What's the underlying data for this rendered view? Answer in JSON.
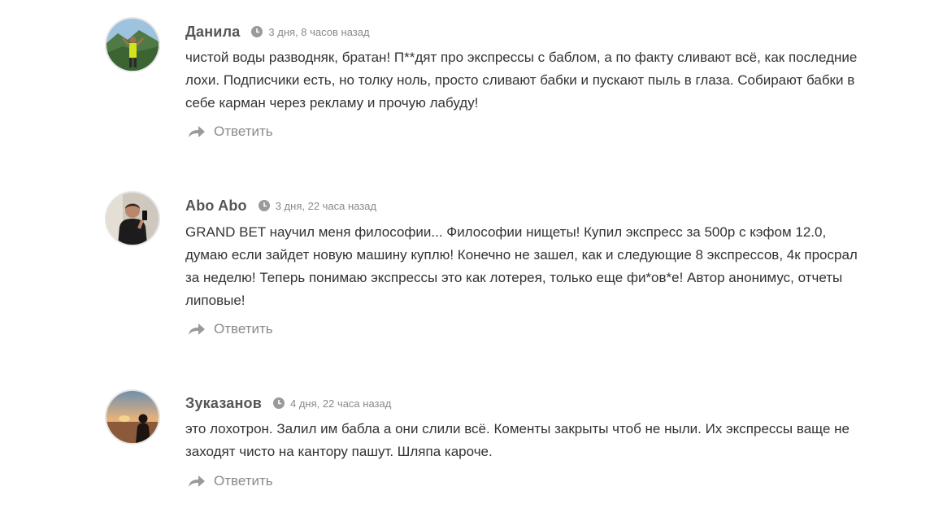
{
  "comments": [
    {
      "author": "Данила",
      "date": "3 дня, 8 часов назад",
      "avatar_icon": "user-photo-mountain",
      "text": "чистой воды разводняк, братан! П**дят про экспрессы с баблом, а по факту сливают всё, как последние лохи. Подписчики есть, но толку ноль, просто сливают бабки и пускают пыль в глаза. Собирают бабки в себе карман через рекламу и прочую лабуду!",
      "reply_label": "Ответить"
    },
    {
      "author": "Abo Abo",
      "date": "3 дня, 22 часа назад",
      "avatar_icon": "user-photo-selfie",
      "text": "GRAND BET научил меня философии... Философии нищеты! Купил экспресс за 500р с кэфом 12.0, думаю если зайдет новую машину куплю! Конечно не зашел, как и следующие 8 экспрессов, 4к просрал за неделю! Теперь понимаю экспрессы это как лотерея, только еще фи*ов*е! Автор анонимус, отчеты липовые!",
      "reply_label": "Ответить"
    },
    {
      "author": "Зуказанов",
      "date": "4 дня, 22 часа назад",
      "avatar_icon": "user-photo-sunset",
      "text": "это лохотрон. Залил им бабла а они слили всё. Коменты закрыты чтоб не ныли. Их экспрессы ваще не заходят чисто на кантору пашут. Шляпа кароче.",
      "reply_label": "Ответить"
    }
  ],
  "colors": {
    "author": "#555555",
    "meta": "#8a8a8a",
    "text": "#333333",
    "reply": "#8a8a8a",
    "avatar_border": "#e6e6e6"
  },
  "icons": {
    "clock": "clock-icon",
    "reply": "reply-arrow-icon"
  }
}
